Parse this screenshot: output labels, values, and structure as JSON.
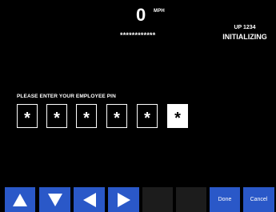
{
  "header": {
    "speed_value": "0",
    "speed_unit": "MPH",
    "speed_mask": "************"
  },
  "unit": {
    "id": "UP 1234",
    "status": "INITIALIZING"
  },
  "pin": {
    "prompt": "PLEASE ENTER YOUR EMPLOYEE PIN",
    "digits": [
      "*",
      "*",
      "*",
      "*",
      "*",
      "*"
    ],
    "active_index": 5
  },
  "toolbar": {
    "up_icon": "triangle-up-icon",
    "down_icon": "triangle-down-icon",
    "left_icon": "triangle-left-icon",
    "right_icon": "triangle-right-icon",
    "done_label": "Done",
    "cancel_label": "Cancel",
    "button_color": "#2a58c8",
    "disabled_color": "#1c1c1c"
  }
}
